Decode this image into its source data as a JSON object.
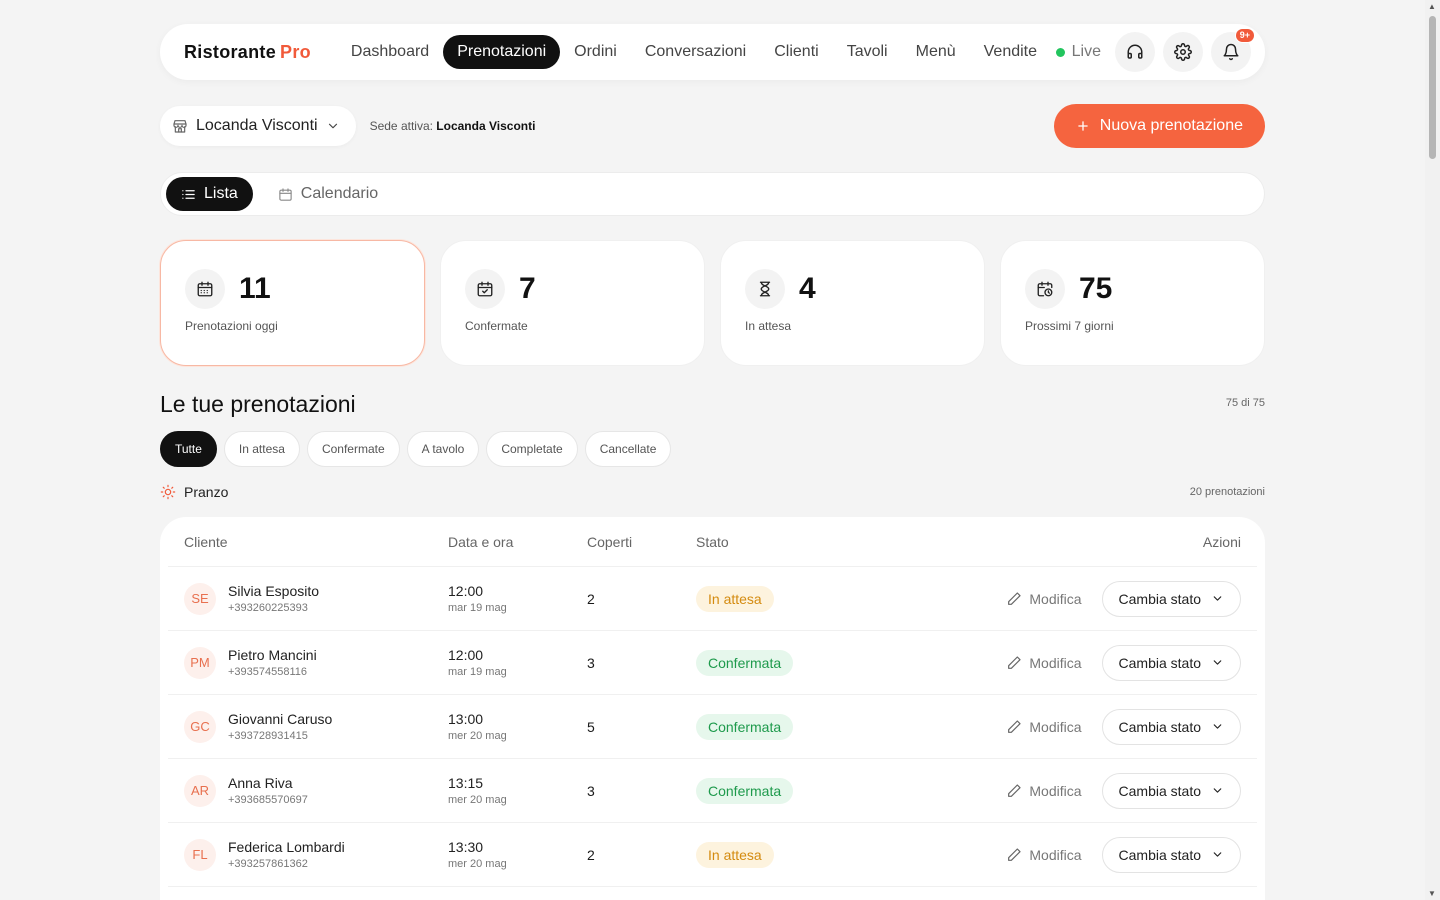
{
  "brand": {
    "name": "Ristorante",
    "suffix": "Pro"
  },
  "nav": {
    "links": [
      "Dashboard",
      "Prenotazioni",
      "Ordini",
      "Conversazioni",
      "Clienti",
      "Tavoli",
      "Menù",
      "Vendite"
    ],
    "active": "Prenotazioni",
    "live_label": "Live",
    "notif_badge": "9+"
  },
  "venue": {
    "selected": "Locanda Visconti",
    "active_prefix": "Sede attiva:",
    "active_name": "Locanda Visconti",
    "new_button": "Nuova prenotazione"
  },
  "view": {
    "list": "Lista",
    "calendar": "Calendario"
  },
  "stats": [
    {
      "value": "11",
      "label": "Prenotazioni oggi",
      "icon": "calendar-icon"
    },
    {
      "value": "7",
      "label": "Confermate",
      "icon": "calendar-check-icon"
    },
    {
      "value": "4",
      "label": "In attesa",
      "icon": "hourglass-icon"
    },
    {
      "value": "75",
      "label": "Prossimi 7 giorni",
      "icon": "calendar-clock-icon"
    }
  ],
  "section": {
    "title": "Le tue prenotazioni",
    "count": "75 di 75"
  },
  "filters": [
    "Tutte",
    "In attesa",
    "Confermate",
    "A tavolo",
    "Completate",
    "Cancellate"
  ],
  "group": {
    "name": "Pranzo",
    "count": "20 prenotazioni"
  },
  "table": {
    "headers": {
      "client": "Cliente",
      "date": "Data e ora",
      "covers": "Coperti",
      "state": "Stato",
      "actions": "Azioni"
    },
    "edit_label": "Modifica",
    "change_label": "Cambia stato",
    "rows": [
      {
        "initials": "SE",
        "name": "Silvia Esposito",
        "phone": "+393260225393",
        "time": "12:00",
        "day": "mar 19 mag",
        "covers": "2",
        "state": "In attesa",
        "state_kind": "wait"
      },
      {
        "initials": "PM",
        "name": "Pietro Mancini",
        "phone": "+393574558116",
        "time": "12:00",
        "day": "mar 19 mag",
        "covers": "3",
        "state": "Confermata",
        "state_kind": "conf"
      },
      {
        "initials": "GC",
        "name": "Giovanni Caruso",
        "phone": "+393728931415",
        "time": "13:00",
        "day": "mer 20 mag",
        "covers": "5",
        "state": "Confermata",
        "state_kind": "conf"
      },
      {
        "initials": "AR",
        "name": "Anna Riva",
        "phone": "+393685570697",
        "time": "13:15",
        "day": "mer 20 mag",
        "covers": "3",
        "state": "Confermata",
        "state_kind": "conf"
      },
      {
        "initials": "FL",
        "name": "Federica Lombardi",
        "phone": "+393257861362",
        "time": "13:30",
        "day": "mer 20 mag",
        "covers": "2",
        "state": "In attesa",
        "state_kind": "wait"
      }
    ]
  },
  "colors": {
    "accent": "#f5643f",
    "live": "#22c55e",
    "wait": "#d48b10",
    "confirmed": "#1e9a4c"
  }
}
